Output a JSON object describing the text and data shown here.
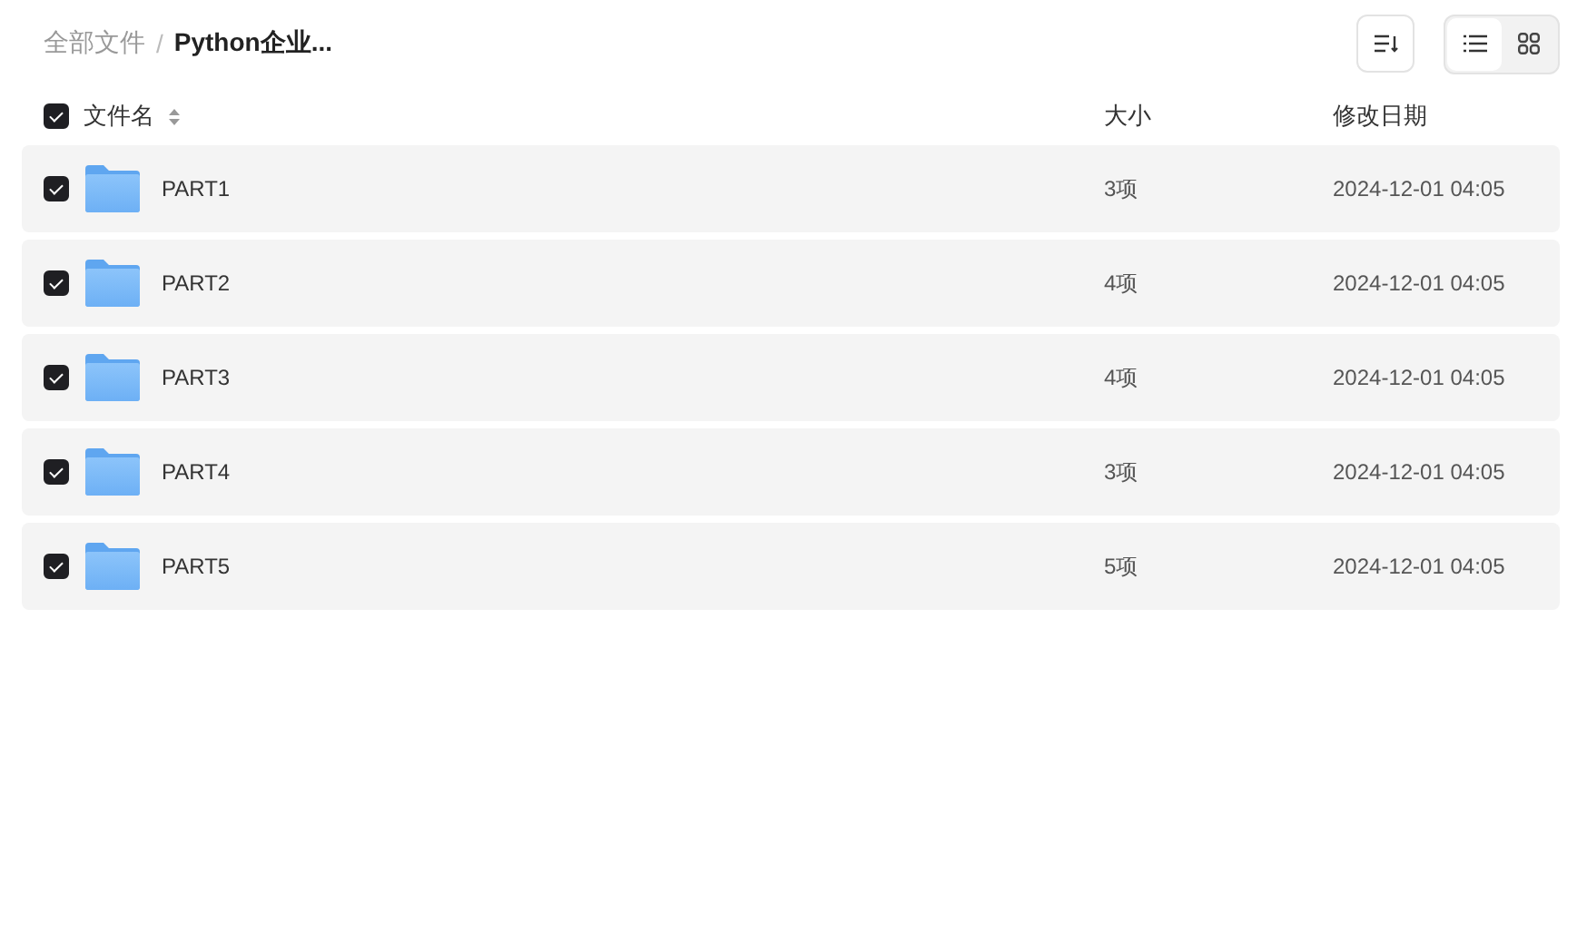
{
  "breadcrumb_separator": "/",
  "breadcrumb": [
    {
      "label": "全部文件",
      "current": false
    },
    {
      "label": "Python企业...",
      "current": true
    }
  ],
  "toolbar": {
    "views": [
      {
        "kind": "list",
        "selected": true
      },
      {
        "kind": "grid",
        "selected": false
      }
    ]
  },
  "table": {
    "all_checked": true,
    "columns": [
      "文件名",
      "大小",
      "修改日期"
    ],
    "rows": [
      {
        "name": "PART1",
        "size": "3项",
        "date": "2024-12-01 04:05",
        "checked": true
      },
      {
        "name": "PART2",
        "size": "4项",
        "date": "2024-12-01 04:05",
        "checked": true
      },
      {
        "name": "PART3",
        "size": "4项",
        "date": "2024-12-01 04:05",
        "checked": true
      },
      {
        "name": "PART4",
        "size": "3项",
        "date": "2024-12-01 04:05",
        "checked": true
      },
      {
        "name": "PART5",
        "size": "5项",
        "date": "2024-12-01 04:05",
        "checked": true
      }
    ]
  }
}
